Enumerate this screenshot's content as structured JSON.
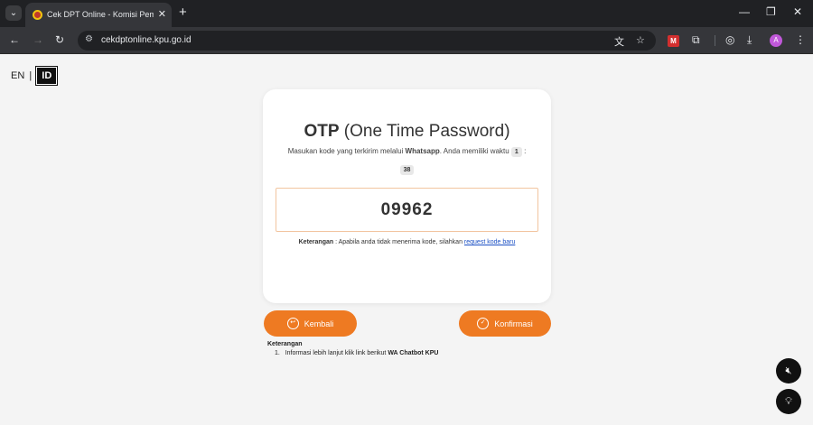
{
  "browser": {
    "tab_title": "Cek DPT Online - Komisi Pemili",
    "url": "cekdptonline.kpu.go.id",
    "profile_initial": "A",
    "extension_label": "M"
  },
  "language": {
    "en": "EN",
    "separator": "|",
    "id": "ID"
  },
  "otp": {
    "title_bold": "OTP",
    "title_rest": "(One Time Password)",
    "desc_pre": "Masukan kode yang terkirim melalui",
    "desc_channel": "Whatsapp",
    "desc_post": ". Anda memiliki waktu",
    "timer_min": "1",
    "timer_sep": ":",
    "timer_sec": "38",
    "code_value": "09962",
    "note_label": "Keterangan",
    "note_text": ": Apabila anda tidak menerima kode, silahkan",
    "note_link": "request kode baru"
  },
  "buttons": {
    "back": "Kembali",
    "confirm": "Konfirmasi"
  },
  "info": {
    "title": "Keterangan",
    "item_number": "1.",
    "item_text": "Informasi lebih lanjut klik link berikut",
    "item_link": "WA Chatbot KPU"
  }
}
